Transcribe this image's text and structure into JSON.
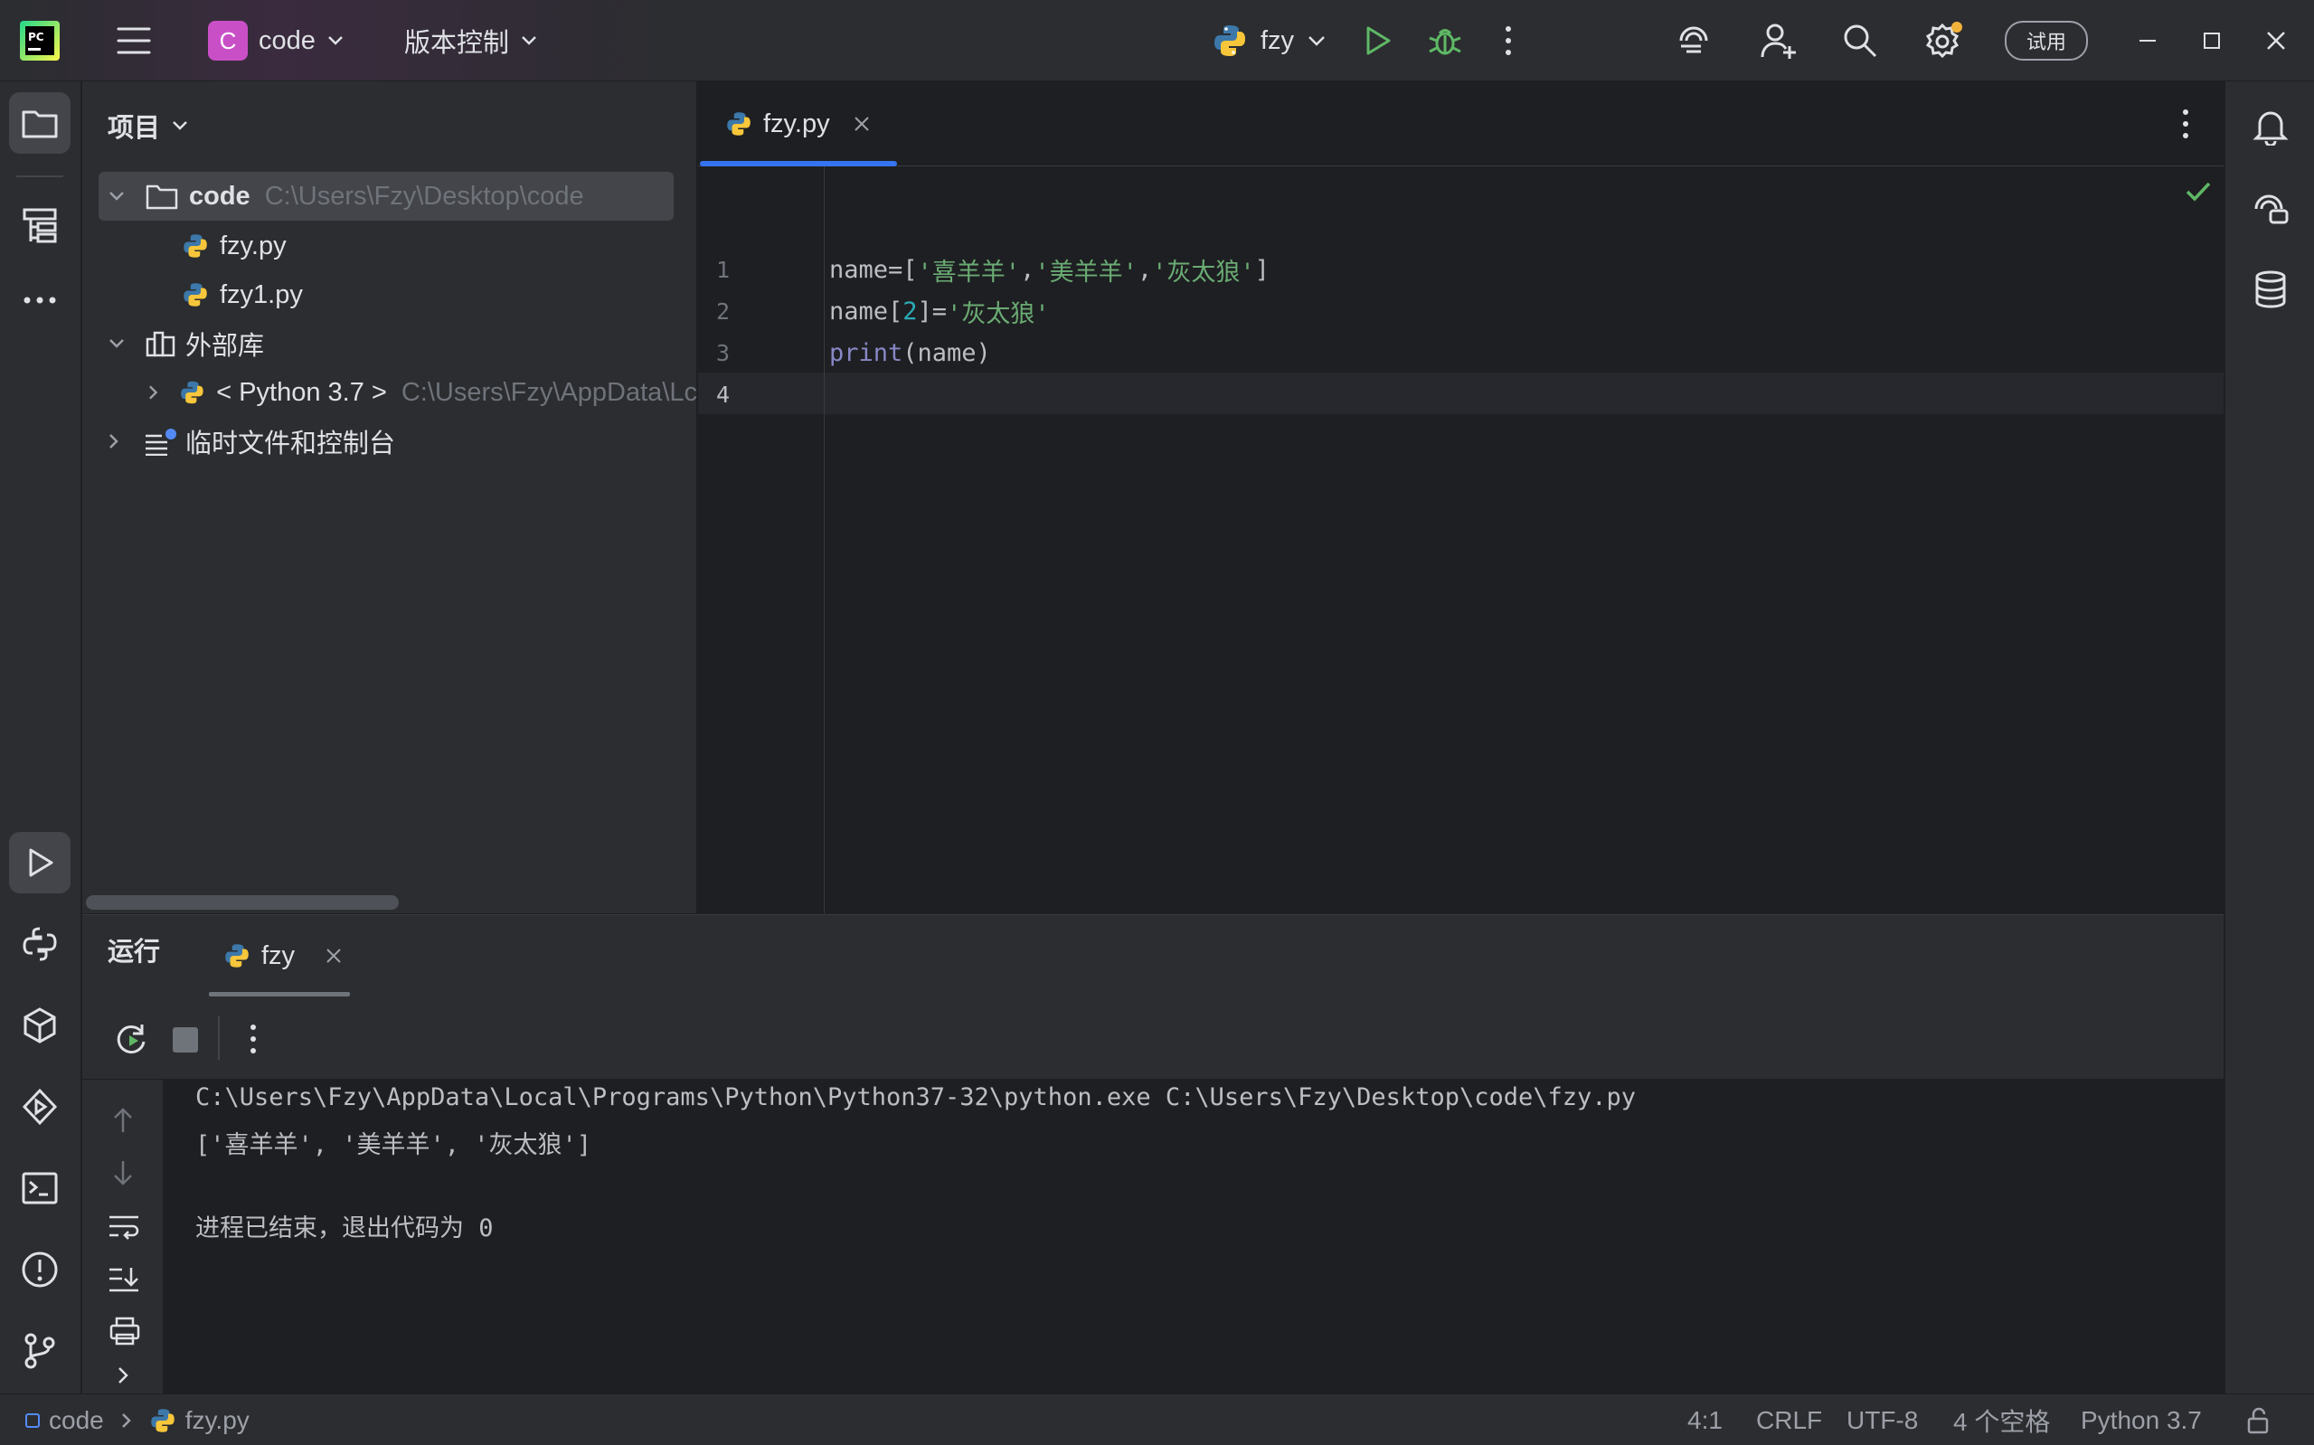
{
  "titlebar": {
    "project_initial": "C",
    "project_name": "code",
    "vcs_menu": "版本控制",
    "run_config": "fzy",
    "trial_badge": "试用"
  },
  "project_panel": {
    "title": "项目",
    "tree": [
      {
        "label": "code",
        "path": "C:\\Users\\Fzy\\Desktop\\code"
      },
      {
        "label": "fzy.py"
      },
      {
        "label": "fzy1.py"
      },
      {
        "label": "外部库"
      },
      {
        "label": "< Python 3.7 >",
        "path": "C:\\Users\\Fzy\\AppData\\Lc"
      },
      {
        "label": "临时文件和控制台"
      }
    ]
  },
  "editor": {
    "tab_label": "fzy.py",
    "line_numbers": [
      "1",
      "2",
      "3",
      "4"
    ],
    "code": {
      "l1": {
        "a": "name=[",
        "b": "'喜羊羊'",
        "c": ",",
        "d": "'美羊羊'",
        "e": ",",
        "f": "'灰太狼'",
        "g": "]"
      },
      "l2": {
        "a": "name[",
        "b": "2",
        "c": "]=",
        "d": "'灰太狼'"
      },
      "l3": {
        "a": "print",
        "b": "(name)"
      }
    }
  },
  "run_panel": {
    "title": "运行",
    "tab_label": "fzy",
    "output": [
      "C:\\Users\\Fzy\\AppData\\Local\\Programs\\Python\\Python37-32\\python.exe C:\\Users\\Fzy\\Desktop\\code\\fzy.py",
      "['喜羊羊', '美羊羊', '灰太狼']",
      "",
      "进程已结束，退出代码为 0"
    ]
  },
  "statusbar": {
    "breadcrumb_project": "code",
    "breadcrumb_file": "fzy.py",
    "caret_position": "4:1",
    "line_separator": "CRLF",
    "encoding": "UTF-8",
    "indent": "4 个空格",
    "interpreter": "Python 3.7"
  },
  "colors": {
    "accent": "#3574f0",
    "run_green": "#5fb865",
    "project_badge": "#c94fc7",
    "notification_dot": "#f2b23a"
  }
}
